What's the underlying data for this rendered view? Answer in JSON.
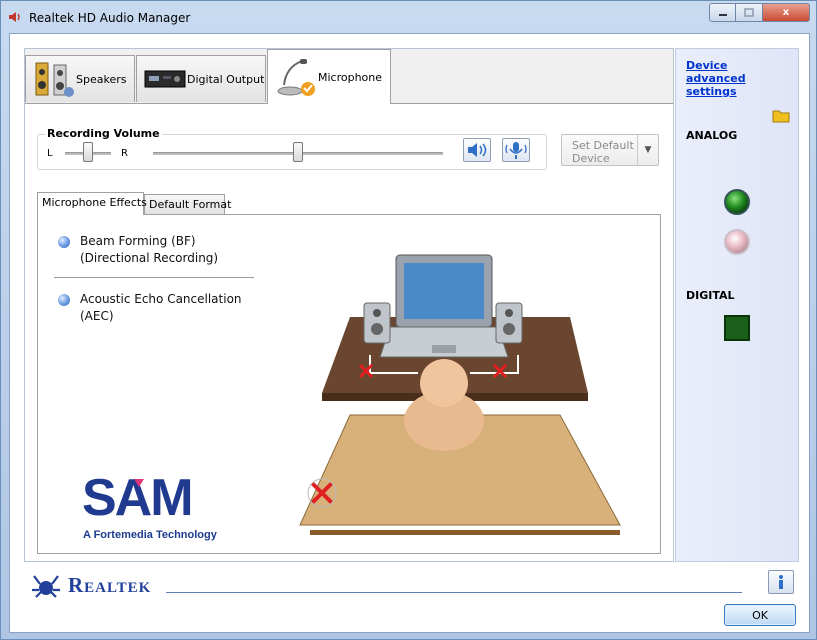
{
  "window": {
    "title": "Realtek HD Audio Manager"
  },
  "caption_buttons": {
    "close": "x"
  },
  "tabs": [
    {
      "label": "Speakers",
      "icon": "speakers-icon"
    },
    {
      "label": "Digital Output",
      "icon": "digital-output-icon"
    },
    {
      "label": "Microphone",
      "icon": "microphone-icon",
      "active": true
    }
  ],
  "recording_volume": {
    "label": "Recording Volume",
    "left_label": "L",
    "right_label": "R",
    "balance_level": 0.5,
    "volume_level": 0.5
  },
  "set_default_device": {
    "label": "Set Default Device",
    "enabled": false
  },
  "subtabs": [
    {
      "label": "Microphone Effects",
      "active": true
    },
    {
      "label": "Default Format"
    }
  ],
  "effects": [
    {
      "line1": "Beam Forming (BF)",
      "line2": "(Directional Recording)"
    },
    {
      "line1": "Acoustic Echo Cancellation",
      "line2": "(AEC)"
    }
  ],
  "sam_logo": {
    "text": "SAM",
    "tagline": "A Fortemedia Technology"
  },
  "right_panel": {
    "device_advanced_settings": "Device advanced settings",
    "analog_label": "ANALOG",
    "digital_label": "DIGITAL"
  },
  "footer": {
    "brand": "Realtek",
    "ok_label": "OK"
  },
  "colors": {
    "link": "#0033cc",
    "brand_blue": "#22409a",
    "jack_green": "#1f8a1f",
    "jack_pink": "#e9b7c4"
  }
}
